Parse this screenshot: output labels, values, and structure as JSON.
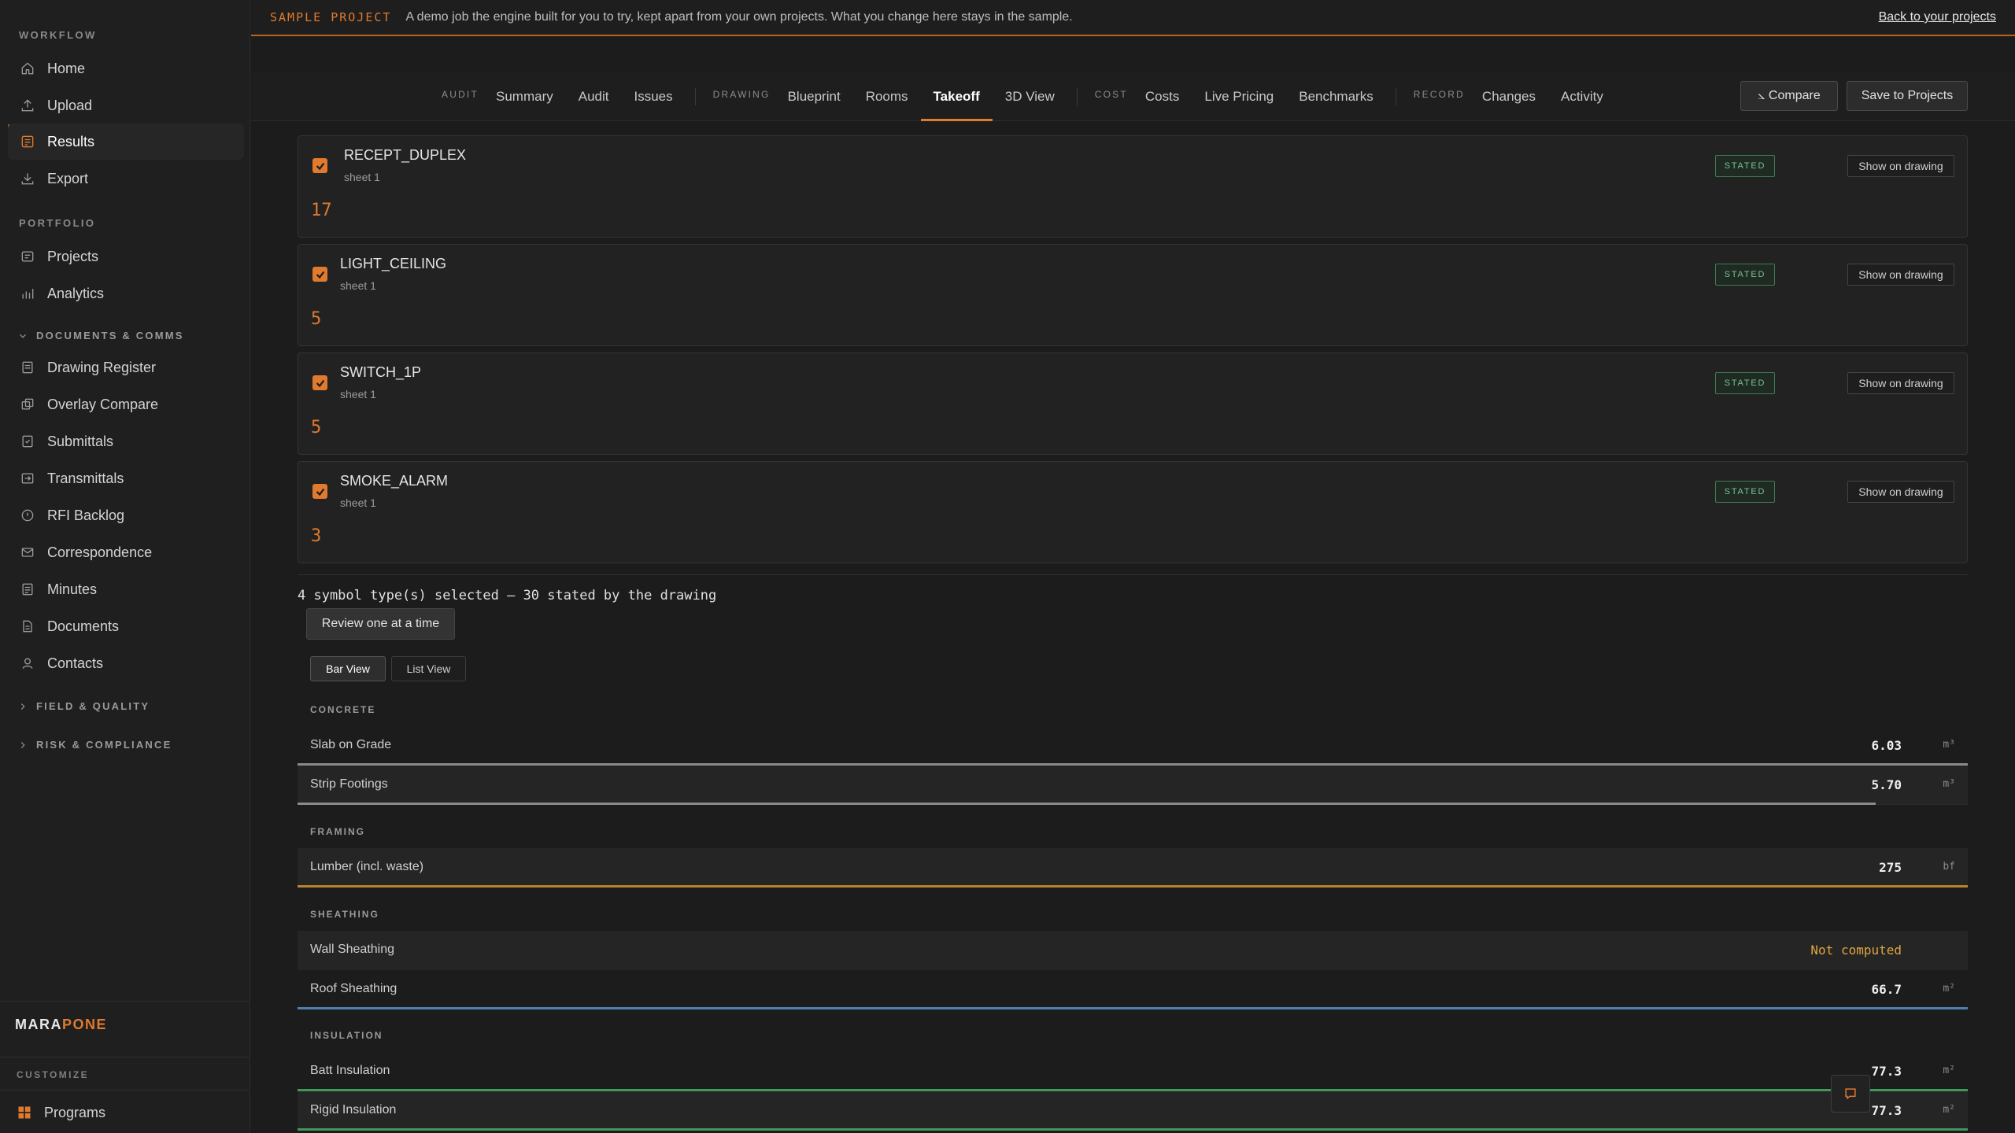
{
  "sidebar": {
    "sections": {
      "workflow": "WORKFLOW",
      "portfolio": "PORTFOLIO",
      "docs_group": "DOCUMENTS & COMMS",
      "field_group": "FIELD & QUALITY",
      "risk_group": "RISK & COMPLIANCE",
      "customize": "CUSTOMIZE"
    },
    "workflow_items": [
      {
        "label": "Home",
        "icon": "home-icon"
      },
      {
        "label": "Upload",
        "icon": "upload-icon"
      },
      {
        "label": "Results",
        "icon": "results-icon",
        "active": true
      },
      {
        "label": "Export",
        "icon": "export-icon"
      }
    ],
    "portfolio_items": [
      {
        "label": "Projects",
        "icon": "projects-icon"
      },
      {
        "label": "Analytics",
        "icon": "analytics-icon"
      }
    ],
    "docs_items": [
      {
        "label": "Drawing Register"
      },
      {
        "label": "Overlay Compare"
      },
      {
        "label": "Submittals"
      },
      {
        "label": "Transmittals"
      },
      {
        "label": "RFI Backlog"
      },
      {
        "label": "Correspondence"
      },
      {
        "label": "Minutes"
      },
      {
        "label": "Documents"
      },
      {
        "label": "Contacts"
      }
    ],
    "brand_main": "MARA",
    "brand_accent": "PONE",
    "programs_label": "Programs"
  },
  "banner": {
    "tag": "SAMPLE PROJECT",
    "message": "A demo job the engine built for you to try, kept apart from your own projects. What you change here stays in the sample.",
    "back_link": "Back to your projects"
  },
  "tabbar": {
    "categories": {
      "audit": "AUDIT",
      "drawing": "DRAWING",
      "cost": "COST",
      "record": "RECORD"
    },
    "tabs": {
      "summary": "Summary",
      "audit": "Audit",
      "issues": "Issues",
      "blueprint": "Blueprint",
      "rooms": "Rooms",
      "takeoff": "Takeoff",
      "view3d": "3D View",
      "costs": "Costs",
      "live_pricing": "Live Pricing",
      "benchmarks": "Benchmarks",
      "changes": "Changes",
      "activity": "Activity"
    },
    "active_tab": "Takeoff",
    "compare_label": "⦣ Compare",
    "save_label": "Save to Projects"
  },
  "symbols": [
    {
      "name": "RECEPT_DUPLEX",
      "sheet": "sheet 1",
      "count": "17",
      "status": "STATED",
      "action": "Show on drawing",
      "checked": true
    },
    {
      "name": "LIGHT_CEILING",
      "sheet": "sheet 1",
      "count": "5",
      "status": "STATED",
      "action": "Show on drawing",
      "checked": true
    },
    {
      "name": "SWITCH_1P",
      "sheet": "sheet 1",
      "count": "5",
      "status": "STATED",
      "action": "Show on drawing",
      "checked": true
    },
    {
      "name": "SMOKE_ALARM",
      "sheet": "sheet 1",
      "count": "3",
      "status": "STATED",
      "action": "Show on drawing",
      "checked": true
    }
  ],
  "selection_summary": "4 symbol type(s) selected — 30 stated by the drawing",
  "review_button": "Review one at a time",
  "view_toggle": {
    "bar": "Bar View",
    "list": "List View",
    "active": "Bar View"
  },
  "quantities": {
    "concrete": {
      "label": "CONCRETE",
      "rows": [
        {
          "name": "Slab on Grade",
          "value": "6.03",
          "unit": "m³",
          "fill": 1.0,
          "color": "#8a8a8a"
        },
        {
          "name": "Strip Footings",
          "value": "5.70",
          "unit": "m³",
          "fill": 0.945,
          "color": "#8a8a8a"
        }
      ]
    },
    "framing": {
      "label": "FRAMING",
      "rows": [
        {
          "name": "Lumber (incl. waste)",
          "value": "275",
          "unit": "bf",
          "fill": 1.0,
          "color": "#b8842e"
        }
      ]
    },
    "sheathing": {
      "label": "SHEATHING",
      "rows": [
        {
          "name": "Wall Sheathing",
          "value": "Not computed",
          "unit": "",
          "fill": 0,
          "color": "#e0a640"
        },
        {
          "name": "Roof Sheathing",
          "value": "66.7",
          "unit": "m²",
          "fill": 1.0,
          "color": "#4f7fae"
        }
      ]
    },
    "insulation": {
      "label": "INSULATION",
      "rows": [
        {
          "name": "Batt Insulation",
          "value": "77.3",
          "unit": "m²",
          "fill": 1.0,
          "color": "#3f9a5a"
        },
        {
          "name": "Rigid Insulation",
          "value": "77.3",
          "unit": "m²",
          "fill": 1.0,
          "color": "#3f9a5a"
        }
      ]
    }
  }
}
